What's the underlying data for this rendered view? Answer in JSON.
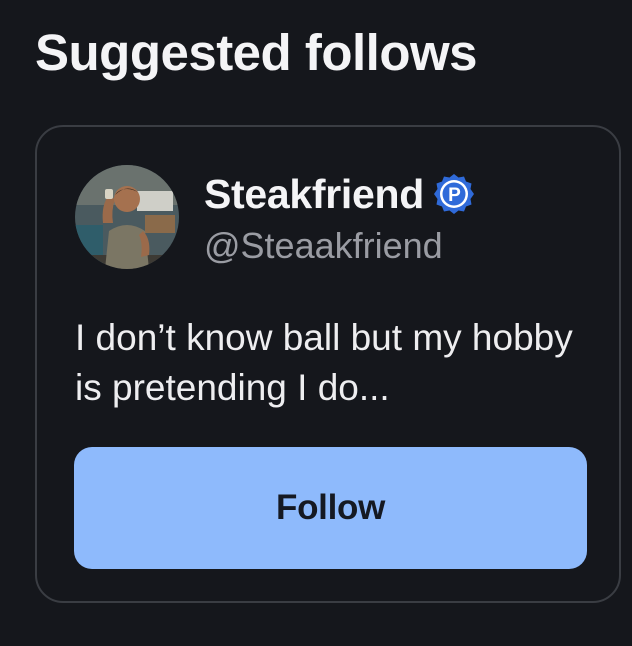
{
  "section": {
    "title": "Suggested follows"
  },
  "suggestion": {
    "display_name": "Steakfriend",
    "handle": "@Steaakfriend",
    "badge": {
      "icon": "verified-p-badge-icon",
      "letter": "P",
      "color": "#2f6ad9"
    },
    "bio": "I don’t know ball but my hobby is pretending I do...",
    "follow_label": "Follow"
  },
  "colors": {
    "background": "#15171c",
    "card_border": "#3a3d43",
    "button": "#8ebafc",
    "button_text": "#151922",
    "handle_text": "#9a9ca3"
  }
}
